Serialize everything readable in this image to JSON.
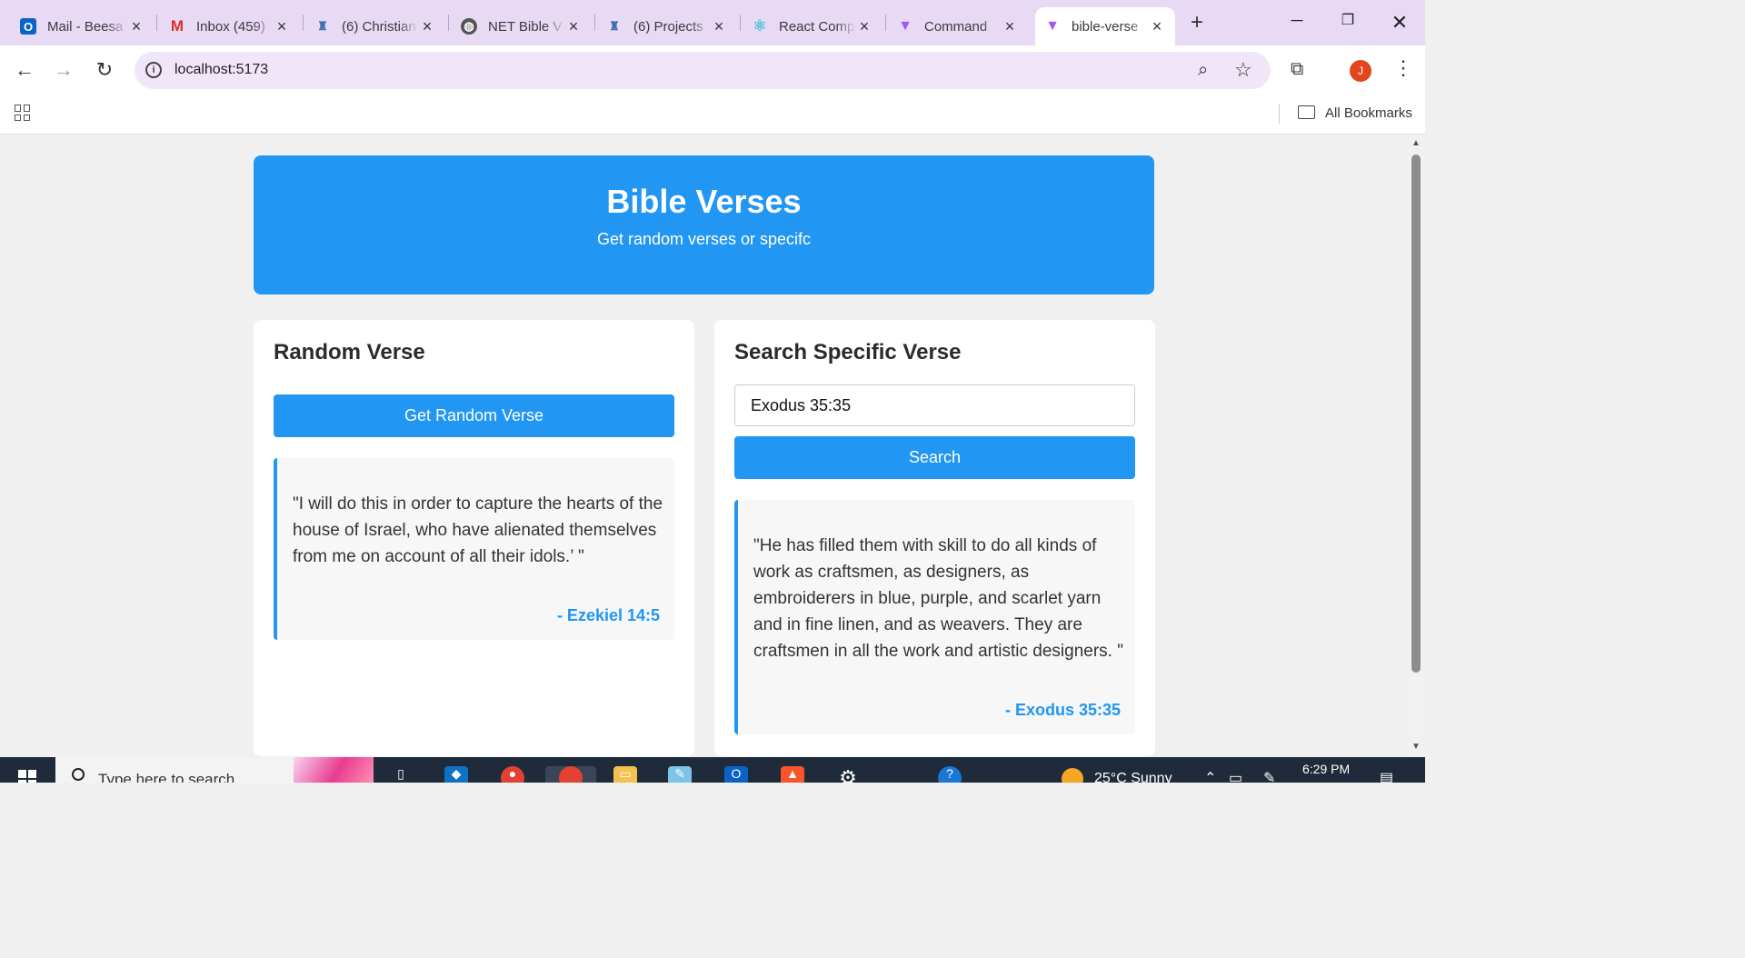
{
  "browser": {
    "tabs": [
      {
        "title": "Mail - Beesa",
        "favicon": "outlook-icon",
        "color": "#0a64c8"
      },
      {
        "title": "Inbox (459)",
        "favicon": "gmail-icon",
        "color": "#d93025"
      },
      {
        "title": "(6) Christian",
        "favicon": "app-icon",
        "color": "#3f6fb5"
      },
      {
        "title": "NET Bible V",
        "favicon": "globe-icon",
        "color": "#555555"
      },
      {
        "title": "(6) Projects",
        "favicon": "app-icon",
        "color": "#3f6fb5"
      },
      {
        "title": "React Comp",
        "favicon": "react-icon",
        "color": "#58c4dc"
      },
      {
        "title": "Command",
        "favicon": "vite-icon",
        "color": "#a855f7"
      },
      {
        "title": "bible-verse",
        "favicon": "vite-icon",
        "color": "#a855f7",
        "active": true
      }
    ],
    "url": "localhost:5173",
    "avatar_initial": "J",
    "bookmarks_label": "All Bookmarks"
  },
  "page": {
    "header": {
      "title": "Bible Verses",
      "subtitle": "Get random verses or specifc"
    },
    "random": {
      "heading": "Random Verse",
      "button_label": "Get Random Verse",
      "verse_text": "\"I will do this in order to capture the hearts of the house of Israel, who have alienated themselves from me on account of all their idols.’ \"",
      "reference": "- Ezekiel 14:5"
    },
    "search": {
      "heading": "Search Specific Verse",
      "input_value": "Exodus 35:35",
      "button_label": "Search",
      "verse_text": "\"He has filled them with skill to do all kinds of work as craftsmen, as designers, as embroiderers in blue, purple, and scarlet yarn and in fine linen, and as weavers. They are craftsmen in all the work and artistic designers. \"",
      "reference": "- Exodus 35:35"
    },
    "accent_color": "#2196f3"
  },
  "taskbar": {
    "search_placeholder": "Type here to search",
    "weather": "25°C  Sunny",
    "time": "6:29 PM"
  }
}
